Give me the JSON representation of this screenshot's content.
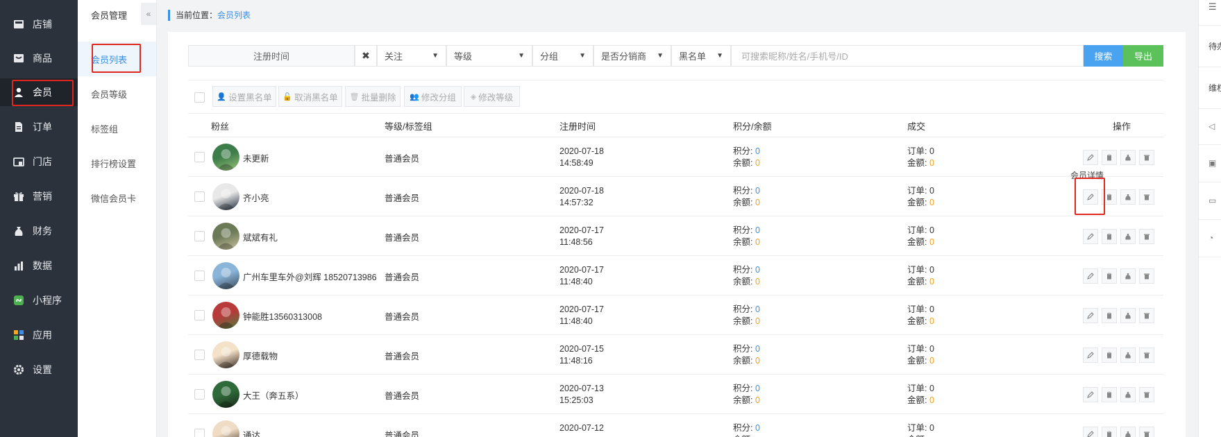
{
  "nav": {
    "items": [
      {
        "label": "店铺",
        "icon": "store-icon"
      },
      {
        "label": "商品",
        "icon": "goods-icon"
      },
      {
        "label": "会员",
        "icon": "user-icon"
      },
      {
        "label": "订单",
        "icon": "order-icon"
      },
      {
        "label": "门店",
        "icon": "shop-icon"
      },
      {
        "label": "营销",
        "icon": "gift-icon"
      },
      {
        "label": "财务",
        "icon": "moneybag-icon"
      },
      {
        "label": "数据",
        "icon": "chart-icon"
      },
      {
        "label": "小程序",
        "icon": "miniprogram-icon"
      },
      {
        "label": "应用",
        "icon": "apps-icon"
      },
      {
        "label": "设置",
        "icon": "gear-icon"
      }
    ],
    "active_index": 2
  },
  "subnav": {
    "title": "会员管理",
    "collapse_glyph": "«",
    "items": [
      {
        "label": "会员列表"
      },
      {
        "label": "会员等级"
      },
      {
        "label": "标签组"
      },
      {
        "label": "排行榜设置"
      },
      {
        "label": "微信会员卡"
      }
    ],
    "active_index": 0
  },
  "breadcrumb": {
    "prefix": "当前位置：",
    "current": "会员列表"
  },
  "filters": {
    "date_placeholder": "注册时间",
    "clear_glyph": "✖",
    "selects": [
      {
        "label": "关注"
      },
      {
        "label": "等级"
      },
      {
        "label": "分组"
      },
      {
        "label": "是否分销商"
      },
      {
        "label": "黑名单"
      }
    ],
    "search_placeholder": "可搜索昵称/姓名/手机号/ID",
    "search_button": "搜索",
    "export_button": "导出"
  },
  "batch": {
    "buttons": [
      {
        "label": "设置黑名单"
      },
      {
        "label": "取消黑名单"
      },
      {
        "label": "批量删除"
      },
      {
        "label": "修改分组"
      },
      {
        "label": "修改等级"
      }
    ]
  },
  "table": {
    "headers": {
      "fans": "粉丝",
      "level": "等级/标签组",
      "reg_time": "注册时间",
      "points": "积分/余额",
      "deal": "成交",
      "ops": "操作"
    },
    "labels": {
      "points": "积分: ",
      "balance": "余额: ",
      "orders": "订单: ",
      "amount": "金额: "
    },
    "rows": [
      {
        "name": "未更新",
        "level": "普通会员",
        "date": "2020-07-18",
        "time": "14:58:49",
        "points": "0",
        "balance": "0",
        "orders": "0",
        "amount": "0"
      },
      {
        "name": "齐小亮",
        "level": "普通会员",
        "date": "2020-07-18",
        "time": "14:57:32",
        "points": "0",
        "balance": "0",
        "orders": "0",
        "amount": "0"
      },
      {
        "name": "斌斌有礼",
        "level": "普通会员",
        "date": "2020-07-17",
        "time": "11:48:56",
        "points": "0",
        "balance": "0",
        "orders": "0",
        "amount": "0"
      },
      {
        "name": "广州车里车外@刘辉 18520713986",
        "level": "普通会员",
        "date": "2020-07-17",
        "time": "11:48:40",
        "points": "0",
        "balance": "0",
        "orders": "0",
        "amount": "0"
      },
      {
        "name": "钟能胜13560313008",
        "level": "普通会员",
        "date": "2020-07-17",
        "time": "11:48:40",
        "points": "0",
        "balance": "0",
        "orders": "0",
        "amount": "0"
      },
      {
        "name": "厚德载物",
        "level": "普通会员",
        "date": "2020-07-15",
        "time": "11:48:16",
        "points": "0",
        "balance": "0",
        "orders": "0",
        "amount": "0"
      },
      {
        "name": "大王（奔五系）",
        "level": "普通会员",
        "date": "2020-07-13",
        "time": "15:25:03",
        "points": "0",
        "balance": "0",
        "orders": "0",
        "amount": "0"
      },
      {
        "name": "通达",
        "level": "普通会员",
        "date": "2020-07-12",
        "time": "",
        "points": "0",
        "balance": "",
        "orders": "0",
        "amount": ""
      }
    ]
  },
  "tooltip": "会员详情",
  "right_strip": {
    "items": [
      "待办",
      "维权"
    ]
  },
  "colors": {
    "accent": "#3a8ee6",
    "search_btn": "#4aa3f0",
    "export_btn": "#5bc15b",
    "highlight": "#e0261f",
    "amount": "#f0a020",
    "nav_bg": "#2b323c"
  }
}
